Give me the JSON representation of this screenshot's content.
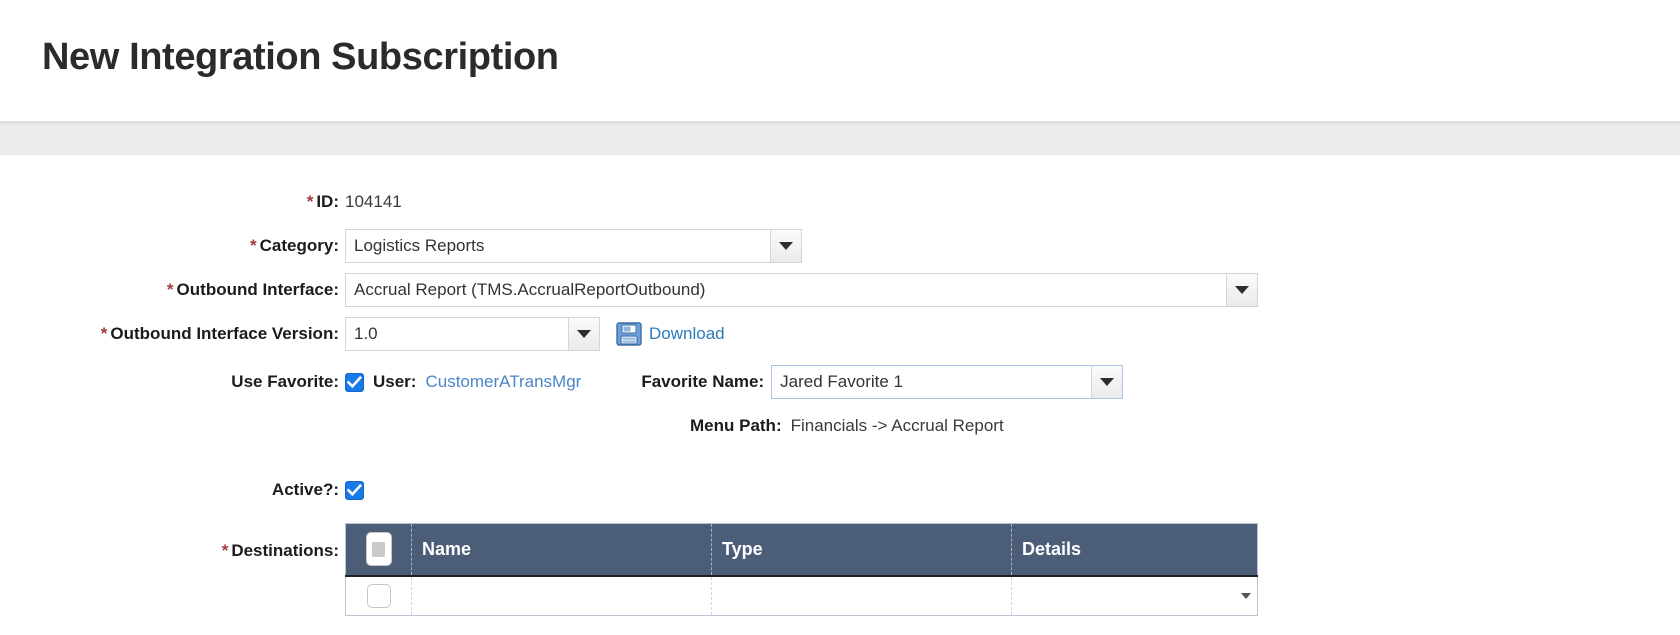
{
  "header": {
    "title": "New Integration Subscription"
  },
  "form": {
    "id": {
      "label": "ID:",
      "required": true,
      "value": "104141"
    },
    "category": {
      "label": "Category:",
      "required": true,
      "value": "Logistics Reports",
      "control": "dropdown",
      "arrow_icon": "chevron-down-icon"
    },
    "outbound_interface": {
      "label": "Outbound Interface:",
      "required": true,
      "value": "Accrual Report (TMS.AccrualReportOutbound)",
      "control": "dropdown",
      "arrow_icon": "chevron-down-icon"
    },
    "outbound_interface_version": {
      "label": "Outbound Interface Version:",
      "required": true,
      "value": "1.0",
      "control": "dropdown",
      "arrow_icon": "chevron-down-icon",
      "download_icon": "floppy-disk-icon",
      "download_label": "Download"
    },
    "use_favorite": {
      "label": "Use Favorite:",
      "required": false,
      "checked": true,
      "checkbox_icon": "checkmark-icon",
      "user_label": "User:",
      "user_value": "CustomerATransMgr"
    },
    "favorite_name": {
      "label": "Favorite Name:",
      "value": "Jared Favorite 1",
      "control": "dropdown",
      "arrow_icon": "chevron-down-icon"
    },
    "menu_path": {
      "label": "Menu Path:",
      "value": "Financials -> Accrual Report"
    },
    "active": {
      "label": "Active?:",
      "required": false,
      "checked": true,
      "checkbox_icon": "checkmark-icon"
    },
    "destinations": {
      "label": "Destinations:",
      "required": true,
      "select_all_icon": "select-all-checkbox-icon",
      "columns": [
        "",
        "Name",
        "Type",
        "Details"
      ],
      "rows": [
        {
          "checked": false,
          "name": "",
          "type": "",
          "details": ""
        }
      ]
    }
  },
  "colors": {
    "table_header_bg": "#4c5d77",
    "accent_checkbox": "#1879e8",
    "link": "#2b7bb9",
    "user_link": "#4a86c5",
    "required_asterisk": "#a33a3a",
    "page_bg": "#ebebeb"
  }
}
